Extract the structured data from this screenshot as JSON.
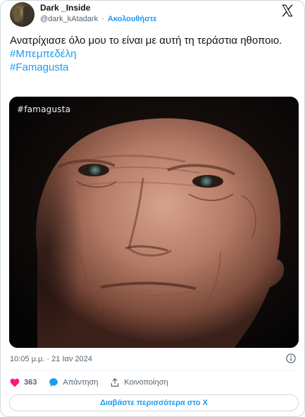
{
  "author": {
    "display_name": "Dark _Inside",
    "handle": "@dark_kAtadark",
    "separator": "·",
    "follow_label": "Ακολουθήστε"
  },
  "tweet": {
    "text": "Ανατρίχιασε όλο μου το είναι με αυτή τη τεράστια ηθοποιο.",
    "hashtags": [
      "#Μπεμπεδέλη",
      "#Famagusta"
    ],
    "media_watermark": "#famagusta",
    "timestamp": "10:05 μ.μ. · 21 Ιαν 2024"
  },
  "actions": {
    "like_count": "363",
    "reply_label": "Απάντηση",
    "share_label": "Κοινοποίηση"
  },
  "read_more_label": "Διαβάστε περισσότερα στο X",
  "colors": {
    "accent": "#1d9bf0",
    "like": "#f91880",
    "text": "#0f1419",
    "muted": "#536471",
    "border": "#cfd9de"
  },
  "icons": [
    "x-logo-icon",
    "info-icon",
    "heart-icon",
    "reply-bubble-icon",
    "share-icon"
  ]
}
